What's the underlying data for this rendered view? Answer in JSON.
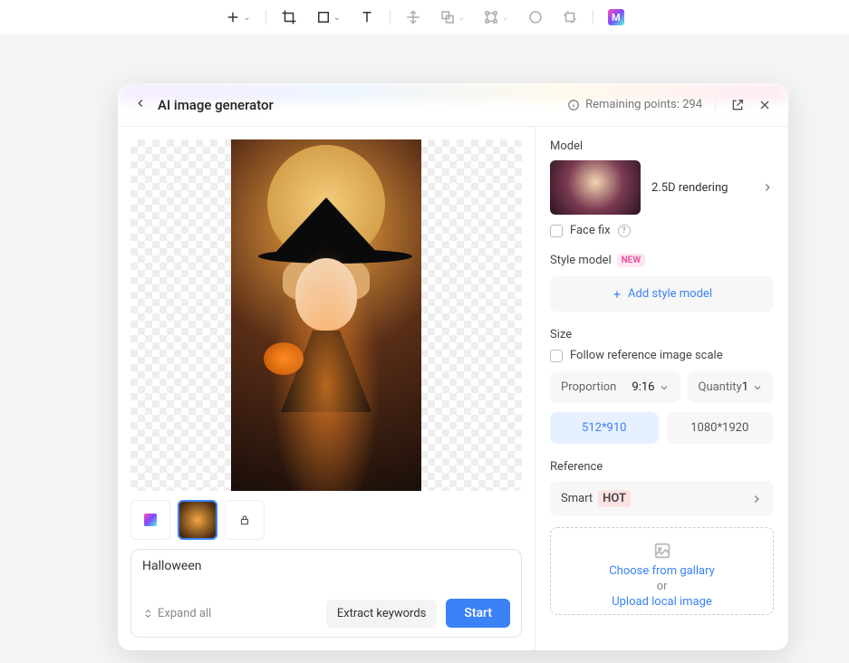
{
  "header": {
    "title": "AI image generator",
    "remaining": "Remaining points: 294"
  },
  "prompt": {
    "text": "Halloween",
    "expand_label": "Expand all",
    "extract_label": "Extract keywords",
    "start_label": "Start"
  },
  "model": {
    "section": "Model",
    "name": "2.5D rendering",
    "facefix_label": "Face fix"
  },
  "style": {
    "section": "Style model",
    "badge": "NEW",
    "add_label": "Add style model"
  },
  "size": {
    "section": "Size",
    "follow_label": "Follow reference image scale",
    "proportion_label": "Proportion",
    "proportion_value": "9:16",
    "quantity_label": "Quantity",
    "quantity_value": "1",
    "opt1": "512*910",
    "opt2": "1080*1920"
  },
  "reference": {
    "section": "Reference",
    "smart_label": "Smart",
    "smart_badge": "HOT",
    "choose_label": "Choose from gallary",
    "or_label": "or",
    "upload_label": "Upload local image"
  }
}
